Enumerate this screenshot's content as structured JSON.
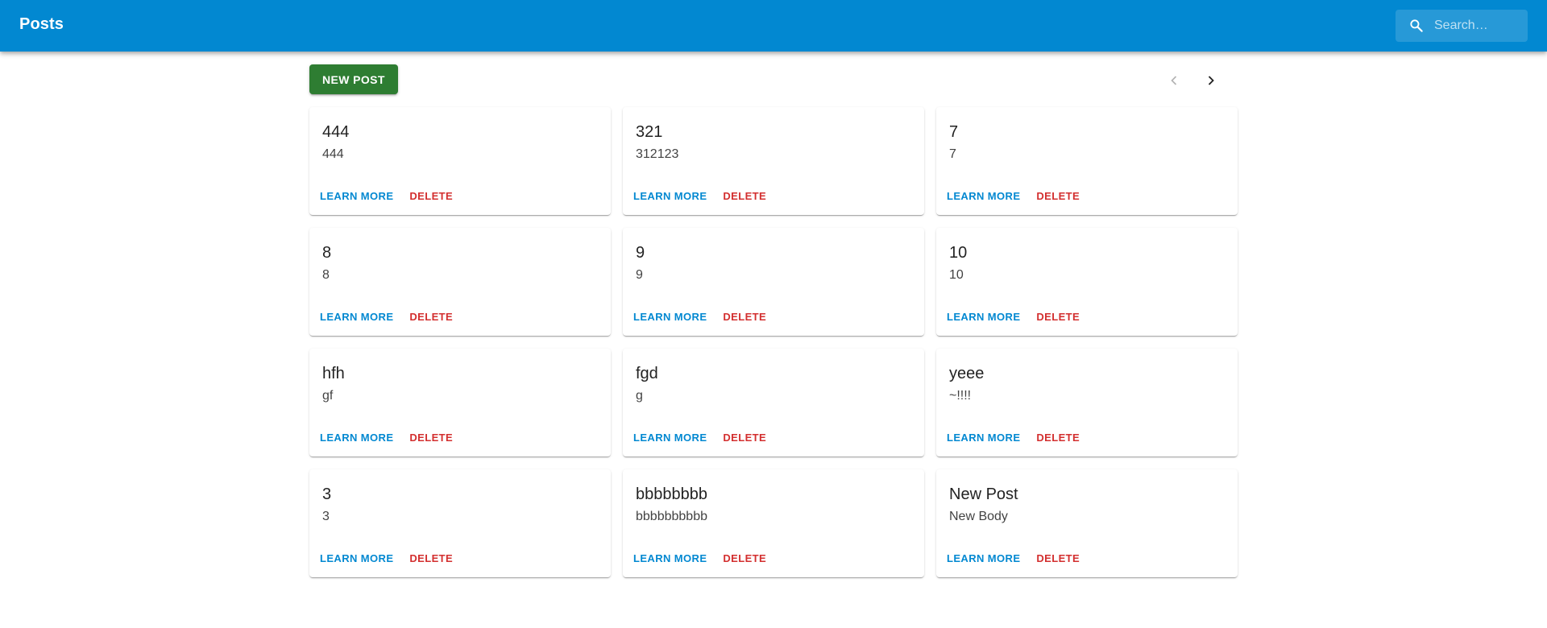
{
  "appbar": {
    "title": "Posts",
    "search": {
      "placeholder": "Search…",
      "value": "",
      "icon": "search-icon"
    },
    "color": "#0288d1"
  },
  "toolbar": {
    "new_post_label": "NEW POST",
    "new_post_color": "#2e7d32",
    "pager": {
      "prev_icon": "chevron-left-icon",
      "prev_disabled": true,
      "next_icon": "chevron-right-icon",
      "next_disabled": false
    }
  },
  "actions": {
    "learn_more": "LEARN MORE",
    "delete": "DELETE",
    "learn_color": "#0288d1",
    "delete_color": "#d32f2f"
  },
  "posts": [
    {
      "title": "444",
      "body": "444"
    },
    {
      "title": "321",
      "body": "312123"
    },
    {
      "title": "7",
      "body": "7"
    },
    {
      "title": "8",
      "body": "8"
    },
    {
      "title": "9",
      "body": "9"
    },
    {
      "title": "10",
      "body": "10"
    },
    {
      "title": "hfh",
      "body": "gf"
    },
    {
      "title": "fgd",
      "body": "g"
    },
    {
      "title": "yeee",
      "body": "~!!!!"
    },
    {
      "title": "3",
      "body": "3"
    },
    {
      "title": "bbbbbbbb",
      "body": "bbbbbbbbbb"
    },
    {
      "title": "New Post",
      "body": "New Body"
    }
  ]
}
